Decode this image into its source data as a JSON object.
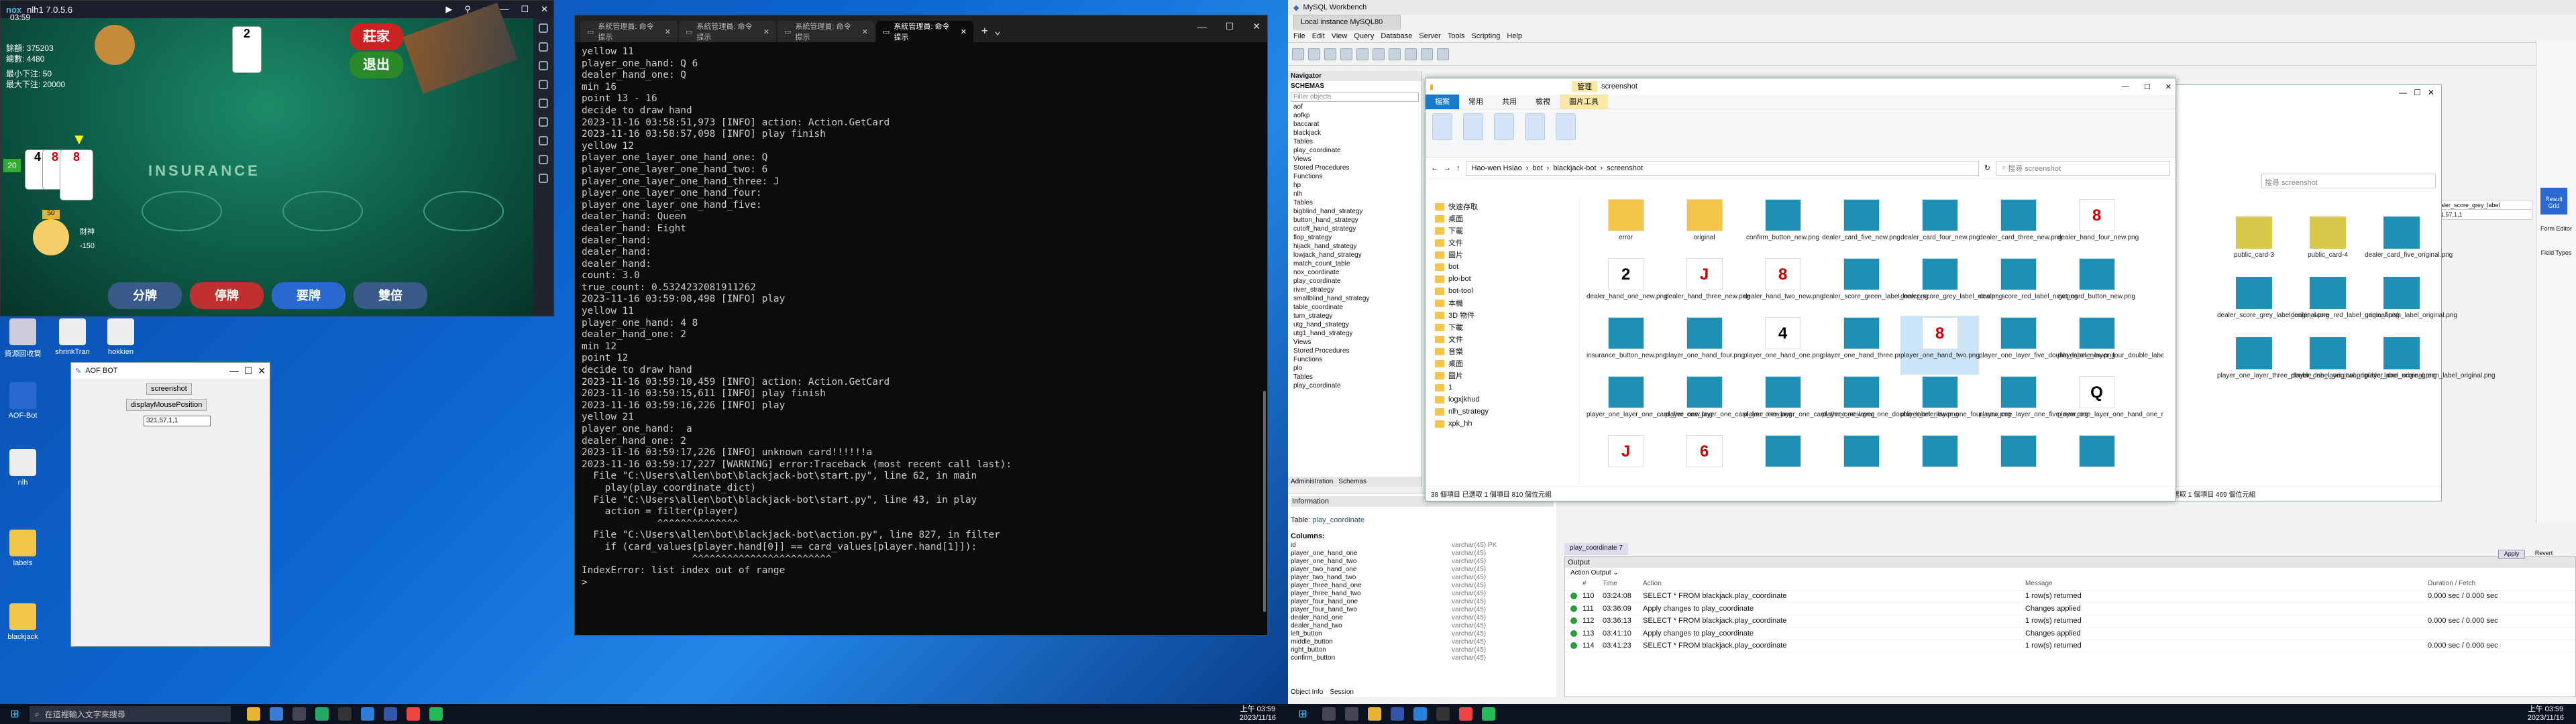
{
  "game": {
    "title": "nlh1 7.0.5.6",
    "time": "03:59",
    "balance_label": "餘額: 375203",
    "bet_label": "總數: 4480",
    "min_bet": "最小下注: 50",
    "max_bet": "最大下注: 20000",
    "btn_stop": "莊家",
    "btn_leave": "退出",
    "insurance": "INSURANCE",
    "player_cards": [
      "4",
      "8",
      "8"
    ],
    "dealer_card": "2",
    "chip_value": "50",
    "score_badge": "20",
    "action_buttons": [
      "分牌",
      "停牌",
      "要牌",
      "雙倍"
    ],
    "player_name": "財神",
    "player_chips": "-150"
  },
  "aof": {
    "title": "AOF BOT",
    "screenshot_btn": "screenshot",
    "display_btn": "displayMousePosition",
    "coords": "321,57,1,1"
  },
  "desktop_icons": [
    "資源回收筒",
    "shrinkTran",
    "hokkien",
    "AOF-Bot",
    "nlh",
    "labels",
    "blackjack"
  ],
  "terminal": {
    "tabs": [
      "系統管理員: 命令提示",
      "系統管理員: 命令提示",
      "系統管理員: 命令提示",
      "系統管理員: 命令提示"
    ],
    "lines": [
      "yellow 11",
      "player_one_hand: Q 6",
      "dealer_hand_one: Q",
      "min 16",
      "point 13 - 16",
      "decide to draw hand",
      "2023-11-16 03:58:51,973 [INFO] action: Action.GetCard",
      "2023-11-16 03:58:57,098 [INFO] play finish",
      "yellow 12",
      "player_one_layer_one_hand_one: Q",
      "player_one_layer_one_hand_two: 6",
      "player_one_layer_one_hand_three: J",
      "player_one_layer_one_hand_four:",
      "player_one_layer_one_hand_five:",
      "dealer_hand: Queen",
      "dealer_hand: Eight",
      "dealer_hand:",
      "dealer_hand:",
      "dealer_hand:",
      "count: 3.0",
      "true_count: 0.5324232081911262",
      "2023-11-16 03:59:08,498 [INFO] play",
      "yellow 11",
      "player_one_hand: 4 8",
      "dealer_hand_one: 2",
      "min 12",
      "point 12",
      "decide to draw hand",
      "2023-11-16 03:59:10,459 [INFO] action: Action.GetCard",
      "2023-11-16 03:59:15,611 [INFO] play finish",
      "2023-11-16 03:59:16,226 [INFO] play",
      "yellow 21",
      "player_one_hand:  a",
      "dealer_hand_one: 2",
      "2023-11-16 03:59:17,226 [INFO] unknown card!!!!!!a",
      "2023-11-16 03:59:17,227 [WARNING] error:Traceback (most recent call last):",
      "  File \"C:\\Users\\allen\\bot\\blackjack-bot\\start.py\", line 62, in main",
      "    play(play_coordinate_dict)",
      "  File \"C:\\Users\\allen\\bot\\blackjack-bot\\start.py\", line 43, in play",
      "    action = filter(player)",
      "             ^^^^^^^^^^^^^^",
      "  File \"C:\\Users\\allen\\bot\\blackjack-bot\\action.py\", line 827, in filter",
      "    if (card_values[player.hand[0]] == card_values[player.hand[1]]):",
      "                   ^^^^^^^^^^^^^^^^^^^^^^^^",
      "IndexError: list index out of range",
      "",
      ">"
    ]
  },
  "taskbar": {
    "search_placeholder": "在這裡輸入文字來搜尋",
    "time": "上午 03:59",
    "date": "2023/11/16",
    "time2": "上午 03:59",
    "date2": "2023/11/16"
  },
  "workbench": {
    "title": "MySQL Workbench",
    "tab": "Local instance MySQL80",
    "menu": [
      "File",
      "Edit",
      "View",
      "Query",
      "Database",
      "Server",
      "Tools",
      "Scripting",
      "Help"
    ],
    "navigator": "Navigator",
    "schemas": "SCHEMAS",
    "filter": "Filter objects",
    "tree": [
      "aof",
      "aofkp",
      "baccarat",
      "blackjack",
      "Tables",
      "play_coordinate",
      "Views",
      "Stored Procedures",
      "Functions",
      "hp",
      "nlh",
      "Tables",
      "bigblind_hand_strategy",
      "button_hand_strategy",
      "cutoff_hand_strategy",
      "flop_strategy",
      "hijack_hand_strategy",
      "lowjack_hand_strategy",
      "match_count_table",
      "nox_coordinate",
      "play_coordinate",
      "river_strategy",
      "smallblind_hand_strategy",
      "table_coordinate",
      "turn_strategy",
      "utg_hand_strategy",
      "utg1_hand_strategy",
      "Views",
      "Stored Procedures",
      "Functions",
      "plo",
      "Tables",
      "play_coordinate"
    ],
    "admin_tabs": [
      "Administration",
      "Schemas"
    ],
    "info_label": "Information",
    "table_label": "Table:",
    "table_name": "play_coordinate",
    "columns_label": "Columns:",
    "columns": [
      [
        "id",
        "varchar(45) PK"
      ],
      [
        "player_one_hand_one",
        "varchar(45)"
      ],
      [
        "player_one_hand_two",
        "varchar(45)"
      ],
      [
        "player_two_hand_one",
        "varchar(45)"
      ],
      [
        "player_two_hand_two",
        "varchar(45)"
      ],
      [
        "player_three_hand_one",
        "varchar(45)"
      ],
      [
        "player_three_hand_two",
        "varchar(45)"
      ],
      [
        "player_four_hand_one",
        "varchar(45)"
      ],
      [
        "player_four_hand_two",
        "varchar(45)"
      ],
      [
        "dealer_hand_one",
        "varchar(45)"
      ],
      [
        "dealer_hand_two",
        "varchar(45)"
      ],
      [
        "left_button",
        "varchar(45)"
      ],
      [
        "middle_button",
        "varchar(45)"
      ],
      [
        "right_button",
        "varchar(45)"
      ],
      [
        "confirm_button",
        "varchar(45)"
      ]
    ],
    "obj_tabs": [
      "Object Info",
      "Session"
    ],
    "query_tab": "play_coordinate 7",
    "output_label": "Output",
    "action_output": "Action Output",
    "out_headers": [
      "#",
      "Time",
      "Action",
      "Message",
      "Duration / Fetch"
    ],
    "out_rows": [
      [
        "110",
        "03:24:08",
        "SELECT * FROM blackjack.play_coordinate",
        "1 row(s) returned",
        "0.000 sec / 0.000 sec"
      ],
      [
        "111",
        "03:36:09",
        "Apply changes to play_coordinate",
        "Changes applied",
        ""
      ],
      [
        "112",
        "03:36:13",
        "SELECT * FROM blackjack.play_coordinate",
        "1 row(s) returned",
        "0.000 sec / 0.000 sec"
      ],
      [
        "113",
        "03:41:10",
        "Apply changes to play_coordinate",
        "Changes applied",
        ""
      ],
      [
        "114",
        "03:41:23",
        "SELECT * FROM blackjack.play_coordinate",
        "1 row(s) returned",
        "0.000 sec / 0.000 sec"
      ]
    ],
    "apply": "Apply",
    "revert": "Revert",
    "result_grid": "Result Grid",
    "form_editor": "Form Editor",
    "field_types": "Field Types",
    "grid_value": "321,57,1,1",
    "grid_col": "dealer_score_grey_label"
  },
  "explorer": {
    "title": "screenshot",
    "manage_tab": "管理",
    "ribbon_tabs": [
      "檔案",
      "常用",
      "共用",
      "檢視",
      "圖片工具"
    ],
    "path": [
      "Hao-wen Hsiao",
      "bot",
      "blackjack-bot",
      "screenshot"
    ],
    "search": "搜尋 screenshot",
    "nav": [
      "快速存取",
      "桌面",
      "下載",
      "文件",
      "圖片",
      "bot",
      "plo-bot",
      "bot-tool",
      "本機",
      "3D 物件",
      "下載",
      "文件",
      "音樂",
      "桌面",
      "圖片",
      "1",
      "logxjkhud",
      "nlh_strategy",
      "xpk_hh"
    ],
    "files": [
      [
        "",
        "error"
      ],
      [
        "",
        "original"
      ],
      [
        "",
        "confirm_button_new.png"
      ],
      [
        "",
        "dealer_card_five_new.png"
      ],
      [
        "",
        "dealer_card_four_new.png"
      ],
      [
        "",
        "dealer_card_three_new.png"
      ],
      [
        "8",
        "dealer_hand_four_new.png"
      ],
      [
        "2",
        "dealer_hand_one_new.png"
      ],
      [
        "J",
        "dealer_hand_three_new.png"
      ],
      [
        "8",
        "dealer_hand_two_new.png"
      ],
      [
        "",
        "dealer_score_green_label_new.png"
      ],
      [
        "",
        "dealer_score_grey_label_new.png"
      ],
      [
        "",
        "dealer_score_red_label_new.png"
      ],
      [
        "",
        "get_card_button_new.png"
      ],
      [
        "",
        "insurance_button_new.png"
      ],
      [
        "",
        "player_one_hand_four.png"
      ],
      [
        "4",
        "player_one_hand_one.png"
      ],
      [
        "",
        "player_one_hand_three.png"
      ],
      [
        "8",
        "player_one_hand_two.png"
      ],
      [
        "",
        "player_one_layer_five_double_label_new.png"
      ],
      [
        "",
        "player_one_layer_four_double_label_new.png"
      ],
      [
        "",
        "player_one_layer_one_card_five_new.png"
      ],
      [
        "",
        "player_one_layer_one_card_four_new.png"
      ],
      [
        "",
        "player_one_layer_one_card_three_new.png"
      ],
      [
        "",
        "player_one_layer_one_double_label_new.png"
      ],
      [
        "",
        "player_one_layer_one_four_new.png"
      ],
      [
        "",
        "player_one_layer_one_five_new.png"
      ],
      [
        "Q",
        "player_one_layer_one_hand_one_new.png"
      ],
      [
        "J",
        ""
      ],
      [
        "6",
        ""
      ],
      [
        "",
        ""
      ],
      [
        "",
        ""
      ],
      [
        "",
        ""
      ],
      [
        "",
        ""
      ],
      [
        "",
        ""
      ]
    ],
    "status": "38 個項目    已選取 1 個項目 810 個位元組"
  },
  "explorer2": {
    "search": "搜尋 screenshot",
    "files": [
      "public_card-3",
      "public_card-4",
      "dealer_card_five_original.png",
      "dealer_score_grey_label_original.png",
      "dealer_score_red_label_original.png",
      "game_finish_label_original.png",
      "player_one_layer_three_double_label_original.png",
      "player_one_layer_two_double_label_original.png",
      "player_one_score_green_label_original.png"
    ],
    "status": "已選取 1 個項目 469 個位元組"
  }
}
